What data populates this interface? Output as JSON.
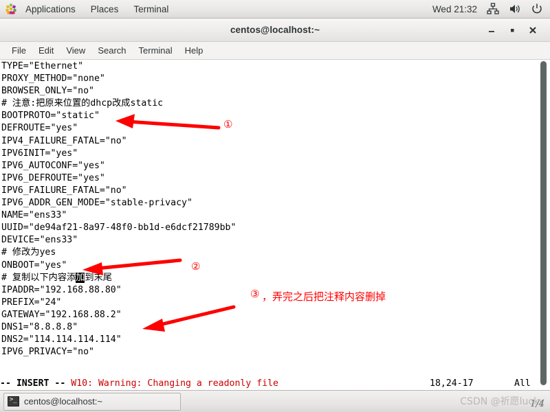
{
  "top_panel": {
    "apps_label": "Applications",
    "places_label": "Places",
    "terminal_label": "Terminal",
    "clock": "Wed 21:32",
    "icons": [
      "network-icon",
      "volume-icon",
      "power-icon"
    ]
  },
  "window": {
    "title": "centos@localhost:~",
    "controls": {
      "minimize": "minimize-button",
      "maximize": "maximize-button",
      "close": "close-button"
    },
    "menubar": [
      "File",
      "Edit",
      "View",
      "Search",
      "Terminal",
      "Help"
    ]
  },
  "terminal": {
    "lines": [
      "TYPE=\"Ethernet\"",
      "PROXY_METHOD=\"none\"",
      "BROWSER_ONLY=\"no\"",
      "# 注意:把原来位置的dhcp改成static",
      "BOOTPROTO=\"static\"",
      "DEFROUTE=\"yes\"",
      "IPV4_FAILURE_FATAL=\"no\"",
      "IPV6INIT=\"yes\"",
      "IPV6_AUTOCONF=\"yes\"",
      "IPV6_DEFROUTE=\"yes\"",
      "IPV6_FAILURE_FATAL=\"no\"",
      "IPV6_ADDR_GEN_MODE=\"stable-privacy\"",
      "NAME=\"ens33\"",
      "UUID=\"de94af21-8a97-48f0-bb1d-e6dcf21789bb\"",
      "DEVICE=\"ens33\"",
      "# 修改为yes",
      "ONBOOT=\"yes\"",
      "",
      "IPADDR=\"192.168.88.80\"",
      "PREFIX=\"24\"",
      "GATEWAY=\"192.168.88.2\"",
      "DNS1=\"8.8.8.8\"",
      "DNS2=\"114.114.114.114\"",
      "IPV6_PRIVACY=\"no\""
    ],
    "cursor_line": {
      "index": 17,
      "before": "# 复制以下内容添",
      "cursor_char": "加",
      "after": "到末尾"
    },
    "status": {
      "mode": "-- INSERT --",
      "warning": "W10: Warning: Changing a readonly file",
      "position": "18,24-17",
      "scroll": "All"
    }
  },
  "annotations": [
    {
      "id": "annotation-1",
      "marker": "①",
      "text": ""
    },
    {
      "id": "annotation-2",
      "marker": "②",
      "text": ""
    },
    {
      "id": "annotation-3",
      "marker": "③",
      "text": "，弄完之后把注释内容删掉"
    }
  ],
  "taskbar": {
    "task_label": "centos@localhost:~",
    "watermark": "CSDN @祈愿lucky",
    "page": "1/4"
  },
  "colors": {
    "annotation_red": "#ff0000",
    "warning_red": "#cc0000",
    "panel_bg": "#f2f1f0",
    "terminal_bg": "#ffffff",
    "terminal_fg": "#000000"
  }
}
